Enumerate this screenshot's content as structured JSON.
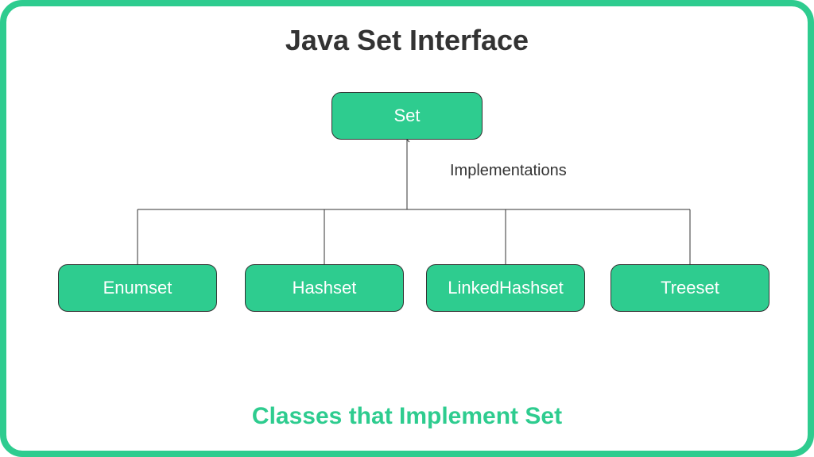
{
  "title": "Java Set Interface",
  "subtitle": "Classes that Implement Set",
  "root": {
    "label": "Set"
  },
  "edge_label": "Implementations",
  "children": [
    {
      "label": "Enumset"
    },
    {
      "label": "Hashset"
    },
    {
      "label": "LinkedHashset"
    },
    {
      "label": "Treeset"
    }
  ]
}
